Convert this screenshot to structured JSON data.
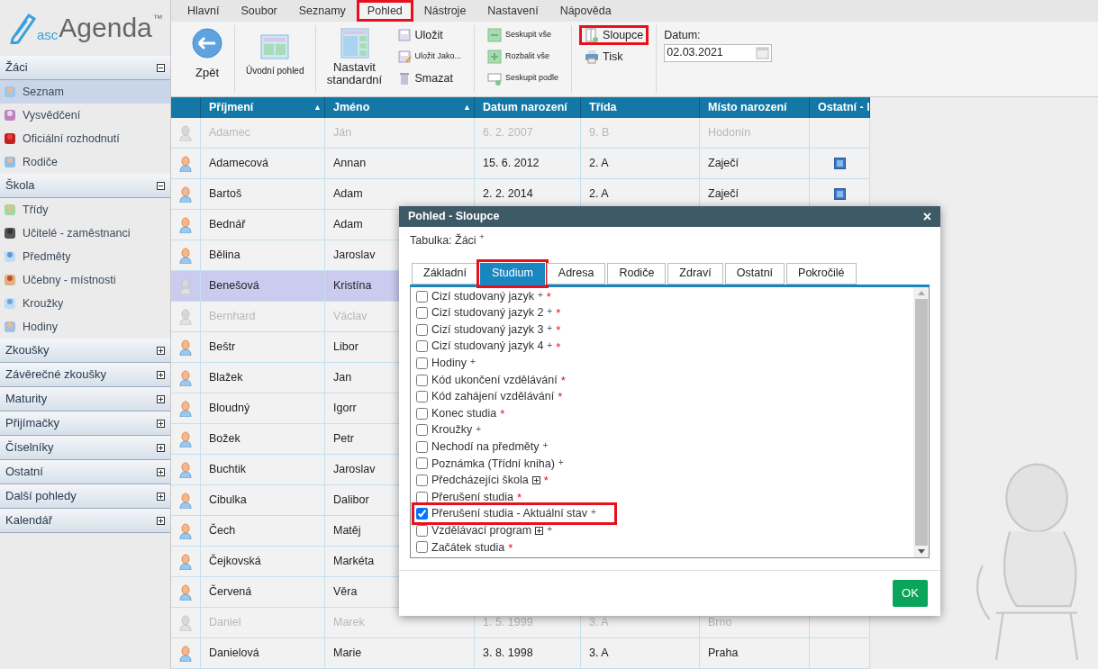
{
  "logo": {
    "prefix": "asc",
    "name": "Agenda",
    "mark": "™"
  },
  "menu": [
    {
      "label": "Hlavní",
      "selected": false,
      "highlighted": false
    },
    {
      "label": "Soubor",
      "selected": false,
      "highlighted": false
    },
    {
      "label": "Seznamy",
      "selected": false,
      "highlighted": false
    },
    {
      "label": "Pohled",
      "selected": true,
      "highlighted": true
    },
    {
      "label": "Nástroje",
      "selected": false,
      "highlighted": false
    },
    {
      "label": "Nastavení",
      "selected": false,
      "highlighted": false
    },
    {
      "label": "Nápověda",
      "selected": false,
      "highlighted": false
    }
  ],
  "ribbon": {
    "groups": [
      {
        "buttons": [
          {
            "label": "Zpět",
            "kind": "large",
            "highlighted": false
          }
        ]
      },
      {
        "buttons": [
          {
            "label": "Úvodní pohled",
            "kind": "large_small_text",
            "highlighted": false
          }
        ]
      },
      {
        "buttons": [
          {
            "label": "Nastavit standardní",
            "kind": "large",
            "highlighted": false
          },
          {
            "label": "Uložit",
            "kind": "small",
            "highlighted": false
          },
          {
            "label": "Uložit Jako...",
            "kind": "tiny",
            "highlighted": false
          },
          {
            "label": "Smazat",
            "kind": "small",
            "highlighted": false
          }
        ]
      },
      {
        "buttons": [
          {
            "label": "Seskupit vše",
            "kind": "tiny",
            "highlighted": false
          },
          {
            "label": "Rozbalit vše",
            "kind": "tiny",
            "highlighted": false
          },
          {
            "label": "Seskupit podle",
            "kind": "tiny",
            "highlighted": false
          }
        ]
      },
      {
        "buttons": [
          {
            "label": "Sloupce",
            "kind": "small",
            "highlighted": true
          },
          {
            "label": "Tisk",
            "kind": "small",
            "highlighted": false
          }
        ]
      }
    ],
    "date": {
      "label": "Datum:",
      "value": "02.03.2021"
    }
  },
  "sidebar": {
    "sections": [
      {
        "title": "Žáci",
        "expanded": true,
        "items": [
          {
            "label": "Seznam",
            "selected": true
          },
          {
            "label": "Vysvědčení",
            "selected": false
          },
          {
            "label": "Oficiální rozhodnutí",
            "selected": false
          },
          {
            "label": "Rodiče",
            "selected": false
          }
        ]
      },
      {
        "title": "Škola",
        "expanded": true,
        "items": [
          {
            "label": "Třídy",
            "selected": false
          },
          {
            "label": "Učitelé - zaměstnanci",
            "selected": false
          },
          {
            "label": "Předměty",
            "selected": false
          },
          {
            "label": "Učebny - místnosti",
            "selected": false
          },
          {
            "label": "Kroužky",
            "selected": false
          },
          {
            "label": "Hodiny",
            "selected": false
          }
        ]
      },
      {
        "title": "Zkoušky",
        "expanded": false
      },
      {
        "title": "Závěrečné zkoušky",
        "expanded": false
      },
      {
        "title": "Maturity",
        "expanded": false
      },
      {
        "title": "Přijímačky",
        "expanded": false
      },
      {
        "title": "Číselníky",
        "expanded": false
      },
      {
        "title": "Ostatní",
        "expanded": false
      },
      {
        "title": "Další pohledy",
        "expanded": false
      },
      {
        "title": "Kalendář",
        "expanded": false
      }
    ]
  },
  "table": {
    "columns": [
      {
        "label": "Příjmení",
        "sort_mark": "▲"
      },
      {
        "label": "Jméno",
        "sort_mark": "▲"
      },
      {
        "label": "Datum narození"
      },
      {
        "label": "Třída"
      },
      {
        "label": "Místo narození"
      },
      {
        "label": "Ostatní - I"
      }
    ],
    "rows": [
      {
        "surname": "Adamec",
        "name": "Ján",
        "birth": "6. 2. 2007",
        "class": "9. B",
        "place": "Hodonín",
        "inactive": true,
        "selected": false
      },
      {
        "surname": "Adamecová",
        "name": "Annan",
        "birth": "15. 6. 2012",
        "class": "2. A",
        "place": "Zaječí",
        "other_icon": true,
        "inactive": false,
        "selected": false
      },
      {
        "surname": "Bartoš",
        "name": "Adam",
        "birth": "2. 2. 2014",
        "class": "2. A",
        "place": "Zaječí",
        "other_icon": true,
        "inactive": false,
        "selected": false
      },
      {
        "surname": "Bednář",
        "name": "Adam",
        "inactive": false,
        "selected": false
      },
      {
        "surname": "Bělina",
        "name": "Jaroslav",
        "inactive": false,
        "selected": false
      },
      {
        "surname": "Benešová",
        "name": "Kristína",
        "inactive": false,
        "selected": true
      },
      {
        "surname": "Bernhard",
        "name": "Václav",
        "inactive": true,
        "selected": false
      },
      {
        "surname": "Beštr",
        "name": "Libor",
        "inactive": false,
        "selected": false
      },
      {
        "surname": "Blažek",
        "name": "Jan",
        "inactive": false,
        "selected": false
      },
      {
        "surname": "Bloudný",
        "name": "Igorr",
        "inactive": false,
        "selected": false
      },
      {
        "surname": "Božek",
        "name": "Petr",
        "inactive": false,
        "selected": false
      },
      {
        "surname": "Buchtik",
        "name": "Jaroslav",
        "inactive": false,
        "selected": false
      },
      {
        "surname": "Cibulka",
        "name": "Dalibor",
        "inactive": false,
        "selected": false
      },
      {
        "surname": "Čech",
        "name": "Matěj",
        "inactive": false,
        "selected": false
      },
      {
        "surname": "Čejkovská",
        "name": "Markéta",
        "inactive": false,
        "selected": false
      },
      {
        "surname": "Červená",
        "name": "Věra",
        "inactive": false,
        "selected": false
      },
      {
        "surname": "Daniel",
        "name": "Marek",
        "birth": "1. 5. 1999",
        "class": "3. A",
        "place": "Brno",
        "inactive": true,
        "selected": false
      },
      {
        "surname": "Danielová",
        "name": "Marie",
        "birth": "3. 8. 1998",
        "class": "3. A",
        "place": "Praha",
        "inactive": false,
        "selected": false
      }
    ]
  },
  "dialog": {
    "title": "Pohled - Sloupce",
    "close": "×",
    "table_label": "Tabulka: Žáci $^{+}$",
    "tabs": [
      {
        "label": "Základní",
        "selected": false,
        "highlighted": false
      },
      {
        "label": "Studium",
        "selected": true,
        "highlighted": true
      },
      {
        "label": "Adresa",
        "selected": false,
        "highlighted": false
      },
      {
        "label": "Rodiče",
        "selected": false,
        "highlighted": false
      },
      {
        "label": "Zdraví",
        "selected": false,
        "highlighted": false
      },
      {
        "label": "Ostatní",
        "selected": false,
        "highlighted": false
      },
      {
        "label": "Pokročilé",
        "selected": false,
        "highlighted": false
      }
    ],
    "items": [
      {
        "label": "Cizí studovaný jazyk",
        "plus_mark": "+",
        "required_mark": "*",
        "checked": false,
        "highlighted": false
      },
      {
        "label": "Cizí studovaný jazyk 2",
        "plus_mark": "+",
        "required_mark": "*",
        "checked": false,
        "highlighted": false
      },
      {
        "label": "Cizí studovaný jazyk 3",
        "plus_mark": "+",
        "required_mark": "*",
        "checked": false,
        "highlighted": false
      },
      {
        "label": "Cizí studovaný jazyk 4",
        "plus_mark": "+",
        "required_mark": "*",
        "checked": false,
        "highlighted": false
      },
      {
        "label": "Hodiny",
        "plus_mark": "+",
        "checked": false,
        "highlighted": false
      },
      {
        "label": "Kód ukončení vzdělávání",
        "required_mark": "*",
        "checked": false,
        "highlighted": false
      },
      {
        "label": "Kód zahájení vzdělávání",
        "required_mark": "*",
        "checked": false,
        "highlighted": false
      },
      {
        "label": "Konec studia",
        "required_mark": "*",
        "checked": false,
        "highlighted": false
      },
      {
        "label": "Kroužky",
        "plus_mark": "+",
        "checked": false,
        "highlighted": false
      },
      {
        "label": "Nechodí na předměty",
        "plus_mark": "+",
        "checked": false,
        "highlighted": false
      },
      {
        "label": "Poznámka (Třídní kniha)",
        "plus_mark": "+",
        "checked": false,
        "highlighted": false
      },
      {
        "label": "Předcházejíci škola",
        "expandable": true,
        "required_mark": "*",
        "checked": false,
        "highlighted": false
      },
      {
        "label": "Přerušení studia",
        "required_mark": "*",
        "checked": false,
        "highlighted": false
      },
      {
        "label": "Přerušení studia - Aktuální stav",
        "plus_mark": "+",
        "checked": true,
        "highlighted": true
      },
      {
        "label": "Vzdělávací program",
        "expandable": true,
        "plus_mark": "+",
        "checked": false,
        "highlighted": false
      },
      {
        "label": "Začátek studia",
        "required_mark": "*",
        "checked": false,
        "highlighted": false
      }
    ],
    "ok": "OK"
  }
}
